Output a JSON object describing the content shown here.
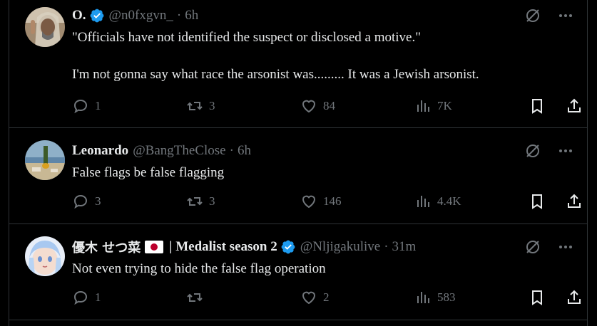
{
  "posts": [
    {
      "name": "O.",
      "verified": true,
      "handle": "@n0fxgvn_",
      "time": "6h",
      "text": "\"Officials have not identified the suspect or disclosed a motive.\"\n\nI'm not gonna say what race the arsonist was......... It was a Jewish arsonist.",
      "replies": "1",
      "reposts": "3",
      "likes": "84",
      "views": "7K"
    },
    {
      "name": "Leonardo",
      "verified": false,
      "handle": "@BangTheClose",
      "time": "6h",
      "text": "False flags be false flagging",
      "replies": "3",
      "reposts": "3",
      "likes": "146",
      "views": "4.4K"
    },
    {
      "name": "優木 せつ菜",
      "name_suffix": "| Medalist season 2",
      "verified": true,
      "handle": "@Nljigakulive",
      "time": "31m",
      "text": "Not even trying to hide the false flag operation",
      "replies": "1",
      "reposts": "",
      "likes": "2",
      "views": "583"
    }
  ],
  "colors": {
    "background": "#000000",
    "text": "#e7e9ea",
    "muted": "#71767b",
    "verified": "#1d9bf0",
    "border": "#2f3336"
  },
  "icons": [
    "grok-icon",
    "more-icon",
    "reply-icon",
    "repost-icon",
    "like-icon",
    "views-icon",
    "bookmark-icon",
    "share-icon",
    "verified-icon",
    "japan-flag-icon"
  ]
}
